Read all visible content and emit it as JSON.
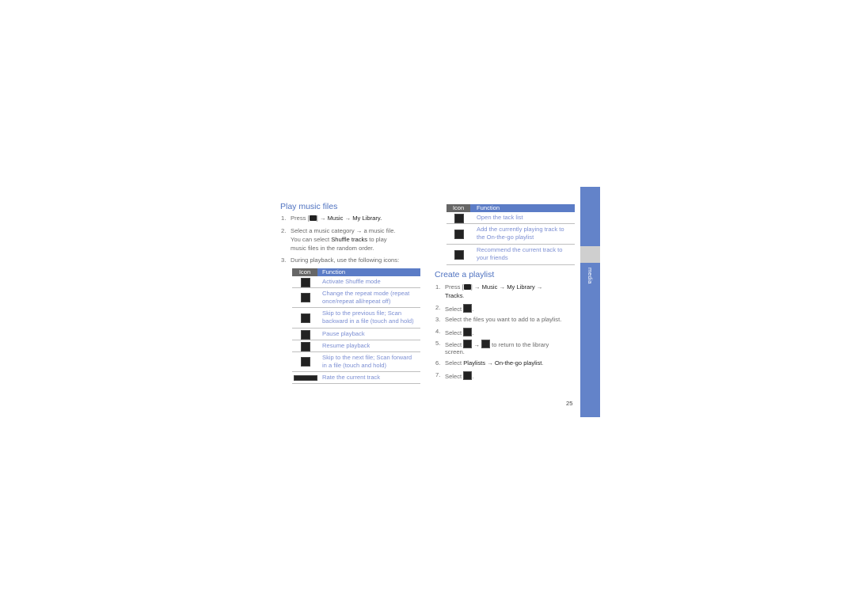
{
  "left": {
    "title": "Play music files",
    "steps": [
      {
        "num": "1.",
        "parts": [
          "Press [",
          "] ",
          "→",
          " Music ",
          "→",
          " My Library."
        ]
      },
      {
        "num": "2.",
        "line1a": "Select a music category ",
        "arrow": "→",
        "line1b": " a music file.",
        "line2a": "You can select ",
        "line2bold": "Shuffle tracks",
        "line2b": " to play",
        "line3": "music files in the random order."
      },
      {
        "num": "3.",
        "text": "During playback, use the following icons:"
      }
    ],
    "table": {
      "header": {
        "icon": "Icon",
        "function": "Function"
      },
      "rows": [
        {
          "icon": "shuffle-icon",
          "lines": [
            "Activate Shuffle mode"
          ]
        },
        {
          "icon": "repeat-icon",
          "lines": [
            "Change the repeat mode (repeat",
            "once/repeat all/repeat off)"
          ]
        },
        {
          "icon": "skip-previous-icon",
          "lines": [
            "Skip to the previous file; Scan",
            "backward in a file (touch and hold)"
          ]
        },
        {
          "icon": "pause-icon",
          "lines": [
            "Pause playback"
          ]
        },
        {
          "icon": "play-icon",
          "lines": [
            "Resume playback"
          ]
        },
        {
          "icon": "skip-next-icon",
          "lines": [
            "Skip to the next file; Scan forward",
            "in a file (touch and hold)"
          ]
        },
        {
          "icon": "rating-stars-icon",
          "lines": [
            "Rate the current track"
          ]
        }
      ]
    }
  },
  "right": {
    "table": {
      "header": {
        "icon": "Icon",
        "function": "Function"
      },
      "rows": [
        {
          "icon": "track-list-icon",
          "lines": [
            "Open the tack list"
          ]
        },
        {
          "icon": "add-to-playlist-icon",
          "lines": [
            "Add the currently playing track to",
            "the On-the-go playlist"
          ]
        },
        {
          "icon": "recommend-icon",
          "lines": [
            "Recommend the current track to",
            "your friends"
          ]
        }
      ]
    },
    "title": "Create a playlist",
    "steps": {
      "s1": {
        "num": "1.",
        "a": "Press [",
        "b": "] ",
        "arrow": "→",
        "music": " Music ",
        "mylib": " My Library ",
        "tracks": "Tracks",
        "dot": "."
      },
      "s2": {
        "num": "2.",
        "a": "Select ",
        "b": "."
      },
      "s3": {
        "num": "3.",
        "text": "Select the files you want to add to a playlist."
      },
      "s4": {
        "num": "4.",
        "a": "Select ",
        "b": "."
      },
      "s5": {
        "num": "5.",
        "a": "Select ",
        "arrow": " → ",
        "b": " to return to the library",
        "c": "screen."
      },
      "s6": {
        "num": "6.",
        "a": "Select ",
        "playlists": "Playlists",
        "arrow": " → ",
        "otg": "On-the-go playlist",
        "b": "."
      },
      "s7": {
        "num": "7.",
        "a": "Select ",
        "b": "."
      }
    }
  },
  "sidebar": {
    "label": "media"
  },
  "page_number": "25"
}
